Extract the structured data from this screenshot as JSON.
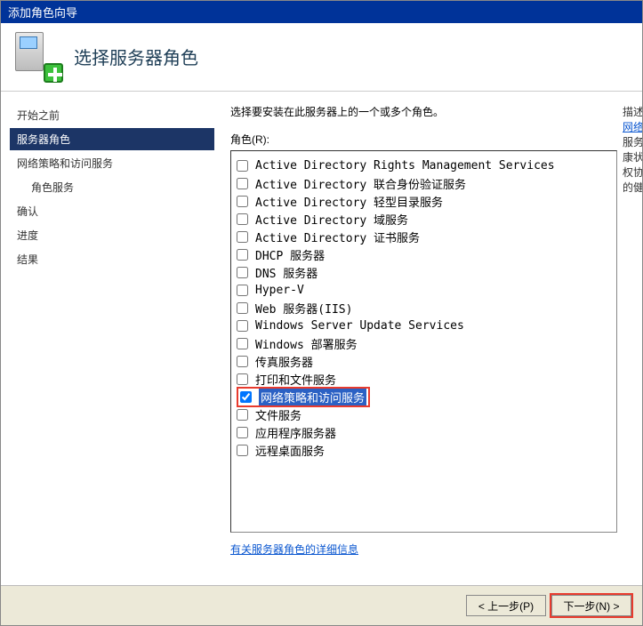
{
  "window": {
    "title": "添加角色向导"
  },
  "header": {
    "title": "选择服务器角色"
  },
  "sidebar": {
    "items": [
      {
        "label": "开始之前",
        "active": false,
        "indent": 0
      },
      {
        "label": "服务器角色",
        "active": true,
        "indent": 0
      },
      {
        "label": "网络策略和访问服务",
        "active": false,
        "indent": 0
      },
      {
        "label": "角色服务",
        "active": false,
        "indent": 1
      },
      {
        "label": "确认",
        "active": false,
        "indent": 0
      },
      {
        "label": "进度",
        "active": false,
        "indent": 0
      },
      {
        "label": "结果",
        "active": false,
        "indent": 0
      }
    ]
  },
  "main": {
    "instruction": "选择要安装在此服务器上的一个或多个角色。",
    "roles_label": "角色(R):",
    "roles": [
      {
        "label": "Active Directory Rights Management Services",
        "checked": false,
        "highlight": false
      },
      {
        "label": "Active Directory 联合身份验证服务",
        "checked": false,
        "highlight": false
      },
      {
        "label": "Active Directory 轻型目录服务",
        "checked": false,
        "highlight": false
      },
      {
        "label": "Active Directory 域服务",
        "checked": false,
        "highlight": false
      },
      {
        "label": "Active Directory 证书服务",
        "checked": false,
        "highlight": false
      },
      {
        "label": "DHCP 服务器",
        "checked": false,
        "highlight": false
      },
      {
        "label": "DNS 服务器",
        "checked": false,
        "highlight": false
      },
      {
        "label": "Hyper-V",
        "checked": false,
        "highlight": false
      },
      {
        "label": "Web 服务器(IIS)",
        "checked": false,
        "highlight": false
      },
      {
        "label": "Windows Server Update Services",
        "checked": false,
        "highlight": false
      },
      {
        "label": "Windows 部署服务",
        "checked": false,
        "highlight": false
      },
      {
        "label": "传真服务器",
        "checked": false,
        "highlight": false
      },
      {
        "label": "打印和文件服务",
        "checked": false,
        "highlight": false
      },
      {
        "label": "网络策略和访问服务",
        "checked": true,
        "highlight": true
      },
      {
        "label": "文件服务",
        "checked": false,
        "highlight": false
      },
      {
        "label": "应用程序服务器",
        "checked": false,
        "highlight": false
      },
      {
        "label": "远程桌面服务",
        "checked": false,
        "highlight": false
      }
    ],
    "info_link": "有关服务器角色的详细信息"
  },
  "right": {
    "heading": "描述",
    "link": "网络",
    "l1": "服务",
    "l2": "康状",
    "l3": "权协",
    "l4": "的健"
  },
  "footer": {
    "back": "< 上一步(P)",
    "next": "下一步(N) >"
  }
}
